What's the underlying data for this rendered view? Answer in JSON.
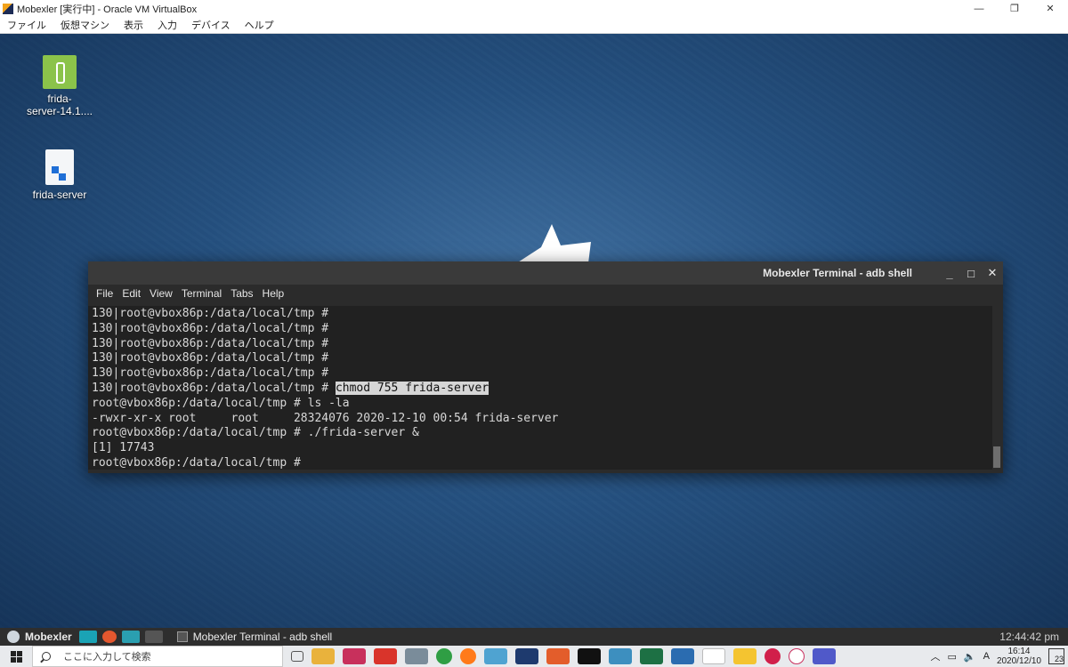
{
  "host_window": {
    "title": "Mobexler [実行中] - Oracle VM VirtualBox",
    "controls": {
      "minimize": "—",
      "restore": "❐",
      "close": "✕"
    },
    "menu": [
      "ファイル",
      "仮想マシン",
      "表示",
      "入力",
      "デバイス",
      "ヘルプ"
    ]
  },
  "desktop": {
    "icons": [
      {
        "label": "frida-\nserver-14.1....",
        "icon": "archive-icon"
      },
      {
        "label": "frida-server",
        "icon": "file-icon"
      }
    ]
  },
  "terminal": {
    "title": "Mobexler Terminal - adb shell",
    "controls": {
      "minimize": "_",
      "maximize": "□",
      "close": "✕"
    },
    "menu": [
      "File",
      "Edit",
      "View",
      "Terminal",
      "Tabs",
      "Help"
    ],
    "lines": [
      {
        "text": "130|root@vbox86p:/data/local/tmp # "
      },
      {
        "text": "130|root@vbox86p:/data/local/tmp # "
      },
      {
        "text": "130|root@vbox86p:/data/local/tmp # "
      },
      {
        "text": "130|root@vbox86p:/data/local/tmp # "
      },
      {
        "text": "130|root@vbox86p:/data/local/tmp # "
      },
      {
        "text": "130|root@vbox86p:/data/local/tmp # ",
        "highlight": "chmod 755 frida-server"
      },
      {
        "text": "root@vbox86p:/data/local/tmp # ls -la"
      },
      {
        "text": "-rwxr-xr-x root     root     28324076 2020-12-10 00:54 frida-server"
      },
      {
        "text": "root@vbox86p:/data/local/tmp # ./frida-server &"
      },
      {
        "text": "[1] 17743"
      },
      {
        "text": "root@vbox86p:/data/local/tmp # "
      }
    ]
  },
  "guest_panel": {
    "brand": "Mobexler",
    "task_label": "Mobexler Terminal - adb shell",
    "clock": "12:44:42 pm"
  },
  "host_taskbar": {
    "search_placeholder": "ここに入力して検索",
    "ime_indicator": "A",
    "time": "16:14",
    "date": "2020/12/10",
    "notification_count": "23"
  }
}
